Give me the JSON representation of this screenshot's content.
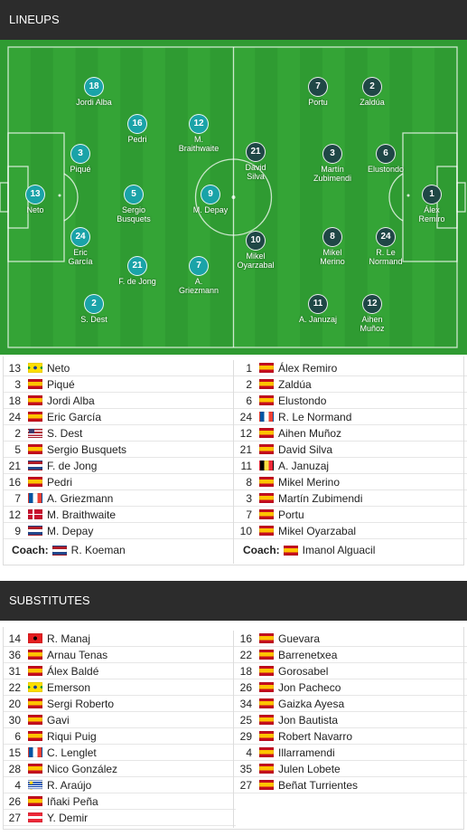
{
  "lineups_title": "LINEUPS",
  "substitutes_title": "SUBSTITUTES",
  "colors": {
    "header": "#2c2c2c",
    "pitch": "#2f9b32",
    "home_marker": "#1aa3a8",
    "away_marker": "#1f4746"
  },
  "home_pitch": [
    {
      "num": "13",
      "name": "Neto"
    },
    {
      "num": "18",
      "name": "Jordi Alba"
    },
    {
      "num": "3",
      "name": "Piqué"
    },
    {
      "num": "24",
      "name": "Eric García"
    },
    {
      "num": "2",
      "name": "S. Dest"
    },
    {
      "num": "16",
      "name": "Pedri"
    },
    {
      "num": "5",
      "name": "Sergio Busquets"
    },
    {
      "num": "21",
      "name": "F. de Jong"
    },
    {
      "num": "12",
      "name": "M. Braithwaite"
    },
    {
      "num": "9",
      "name": "M. Depay"
    },
    {
      "num": "7",
      "name": "A. Griezmann"
    }
  ],
  "away_pitch": [
    {
      "num": "1",
      "name": "Álex Remiro"
    },
    {
      "num": "2",
      "name": "Zaldúa"
    },
    {
      "num": "6",
      "name": "Elustondo"
    },
    {
      "num": "24",
      "name": "R. Le Normand"
    },
    {
      "num": "12",
      "name": "Aihen Muñoz"
    },
    {
      "num": "7",
      "name": "Portu"
    },
    {
      "num": "3",
      "name": "Martín Zubimendi"
    },
    {
      "num": "8",
      "name": "Mikel Merino"
    },
    {
      "num": "11",
      "name": "A. Januzaj"
    },
    {
      "num": "21",
      "name": "David Silva"
    },
    {
      "num": "10",
      "name": "Mikel Oyarzabal"
    }
  ],
  "home_list": [
    {
      "num": "13",
      "flag": "brazil-flag",
      "name": "Neto"
    },
    {
      "num": "3",
      "flag": "spain-flag",
      "name": "Piqué"
    },
    {
      "num": "18",
      "flag": "spain-flag",
      "name": "Jordi Alba"
    },
    {
      "num": "24",
      "flag": "spain-flag",
      "name": "Eric García"
    },
    {
      "num": "2",
      "flag": "usa-flag",
      "name": "S. Dest"
    },
    {
      "num": "5",
      "flag": "spain-flag",
      "name": "Sergio Busquets"
    },
    {
      "num": "21",
      "flag": "netherlands-flag",
      "name": "F. de Jong"
    },
    {
      "num": "16",
      "flag": "spain-flag",
      "name": "Pedri"
    },
    {
      "num": "7",
      "flag": "france-flag",
      "name": "A. Griezmann"
    },
    {
      "num": "12",
      "flag": "denmark-flag",
      "name": "M. Braithwaite"
    },
    {
      "num": "9",
      "flag": "netherlands-flag",
      "name": "M. Depay"
    }
  ],
  "away_list": [
    {
      "num": "1",
      "flag": "spain-flag",
      "name": "Álex Remiro"
    },
    {
      "num": "2",
      "flag": "spain-flag",
      "name": "Zaldúa"
    },
    {
      "num": "6",
      "flag": "spain-flag",
      "name": "Elustondo"
    },
    {
      "num": "24",
      "flag": "france-flag",
      "name": "R. Le Normand"
    },
    {
      "num": "12",
      "flag": "spain-flag",
      "name": "Aihen Muñoz"
    },
    {
      "num": "21",
      "flag": "spain-flag",
      "name": "David Silva"
    },
    {
      "num": "11",
      "flag": "belgium-flag",
      "name": "A. Januzaj"
    },
    {
      "num": "8",
      "flag": "spain-flag",
      "name": "Mikel Merino"
    },
    {
      "num": "3",
      "flag": "spain-flag",
      "name": "Martín Zubimendi"
    },
    {
      "num": "7",
      "flag": "spain-flag",
      "name": "Portu"
    },
    {
      "num": "10",
      "flag": "spain-flag",
      "name": "Mikel Oyarzabal"
    }
  ],
  "coach_label": "Coach:",
  "home_coach": {
    "flag": "netherlands-flag",
    "name": "R. Koeman"
  },
  "away_coach": {
    "flag": "spain-flag",
    "name": "Imanol Alguacil"
  },
  "home_subs": [
    {
      "num": "14",
      "flag": "albania-flag",
      "name": "R. Manaj"
    },
    {
      "num": "36",
      "flag": "spain-flag",
      "name": "Arnau Tenas"
    },
    {
      "num": "31",
      "flag": "spain-flag",
      "name": "Álex Baldé"
    },
    {
      "num": "22",
      "flag": "brazil-flag",
      "name": "Emerson"
    },
    {
      "num": "20",
      "flag": "spain-flag",
      "name": "Sergi Roberto"
    },
    {
      "num": "30",
      "flag": "spain-flag",
      "name": "Gavi"
    },
    {
      "num": "6",
      "flag": "spain-flag",
      "name": "Riqui Puig"
    },
    {
      "num": "15",
      "flag": "france-flag",
      "name": "C. Lenglet"
    },
    {
      "num": "28",
      "flag": "spain-flag",
      "name": "Nico González"
    },
    {
      "num": "4",
      "flag": "uruguay-flag",
      "name": "R. Araújo"
    },
    {
      "num": "26",
      "flag": "spain-flag",
      "name": "Iñaki Peña"
    },
    {
      "num": "27",
      "flag": "austria-flag",
      "name": "Y. Demir"
    }
  ],
  "away_subs": [
    {
      "num": "16",
      "flag": "spain-flag",
      "name": "Guevara"
    },
    {
      "num": "22",
      "flag": "spain-flag",
      "name": "Barrenetxea"
    },
    {
      "num": "18",
      "flag": "spain-flag",
      "name": "Gorosabel"
    },
    {
      "num": "26",
      "flag": "spain-flag",
      "name": "Jon Pacheco"
    },
    {
      "num": "34",
      "flag": "spain-flag",
      "name": "Gaizka Ayesa"
    },
    {
      "num": "25",
      "flag": "spain-flag",
      "name": "Jon Bautista"
    },
    {
      "num": "29",
      "flag": "spain-flag",
      "name": "Robert Navarro"
    },
    {
      "num": "4",
      "flag": "spain-flag",
      "name": "Illarramendi"
    },
    {
      "num": "35",
      "flag": "spain-flag",
      "name": "Julen Lobete"
    },
    {
      "num": "27",
      "flag": "spain-flag",
      "name": "Beñat Turrientes"
    }
  ]
}
